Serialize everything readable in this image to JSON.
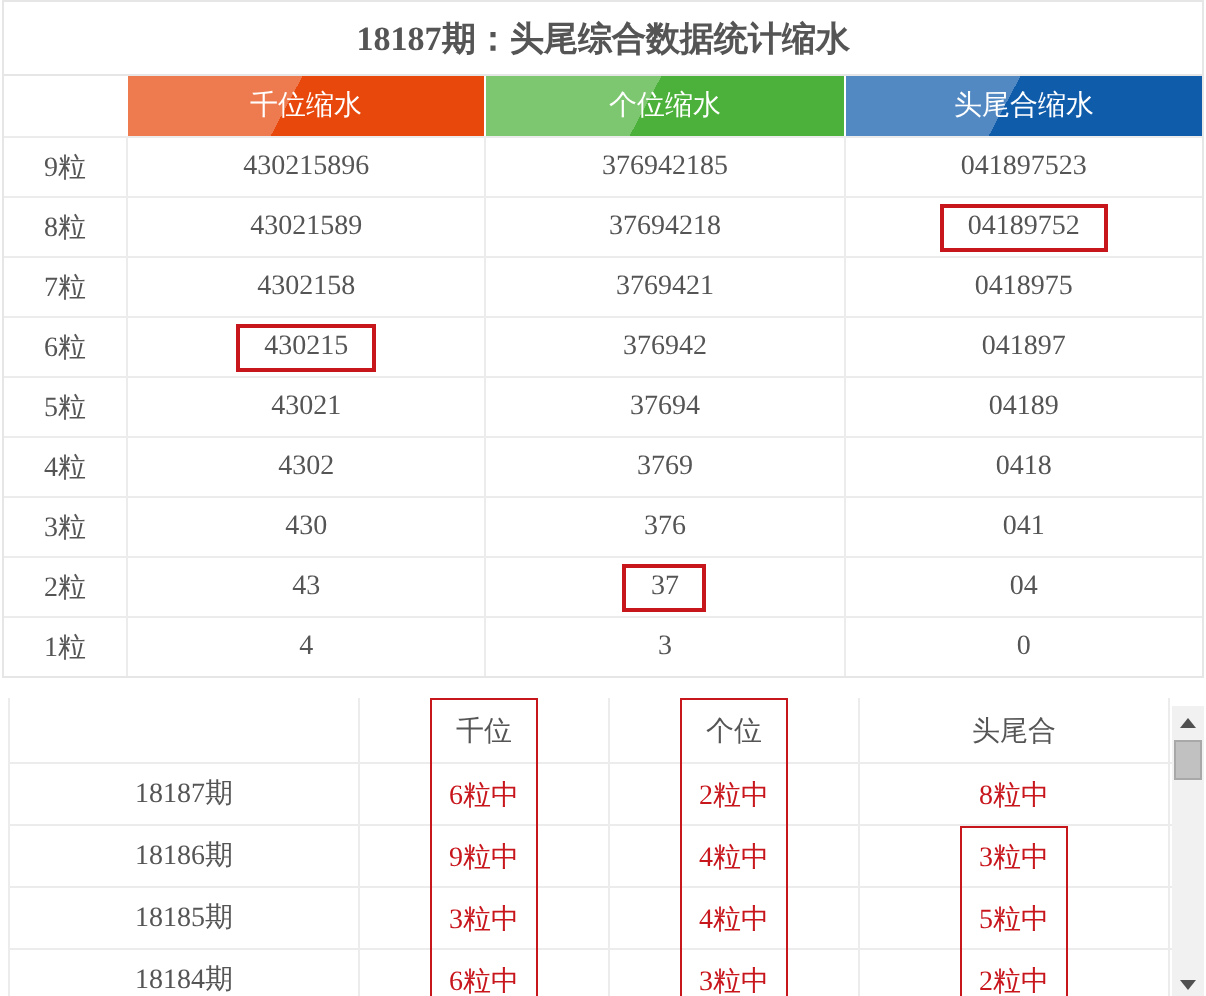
{
  "title": "18187期：头尾综合数据统计缩水",
  "columns": [
    {
      "label": "千位缩水",
      "color": "#e8480c"
    },
    {
      "label": "个位缩水",
      "color": "#4cb13a"
    },
    {
      "label": "头尾合缩水",
      "color": "#0f5cab"
    }
  ],
  "rows": [
    {
      "label": "9粒",
      "cells": [
        {
          "text": "430215896",
          "boxed": false
        },
        {
          "text": "376942185",
          "boxed": false
        },
        {
          "text": "041897523",
          "boxed": false
        }
      ]
    },
    {
      "label": "8粒",
      "cells": [
        {
          "text": "43021589",
          "boxed": false
        },
        {
          "text": "37694218",
          "boxed": false
        },
        {
          "text": "04189752",
          "boxed": true
        }
      ]
    },
    {
      "label": "7粒",
      "cells": [
        {
          "text": "4302158",
          "boxed": false
        },
        {
          "text": "3769421",
          "boxed": false
        },
        {
          "text": "0418975",
          "boxed": false
        }
      ]
    },
    {
      "label": "6粒",
      "cells": [
        {
          "text": "430215",
          "boxed": true
        },
        {
          "text": "376942",
          "boxed": false
        },
        {
          "text": "041897",
          "boxed": false
        }
      ]
    },
    {
      "label": "5粒",
      "cells": [
        {
          "text": "43021",
          "boxed": false
        },
        {
          "text": "37694",
          "boxed": false
        },
        {
          "text": "04189",
          "boxed": false
        }
      ]
    },
    {
      "label": "4粒",
      "cells": [
        {
          "text": "4302",
          "boxed": false
        },
        {
          "text": "3769",
          "boxed": false
        },
        {
          "text": "0418",
          "boxed": false
        }
      ]
    },
    {
      "label": "3粒",
      "cells": [
        {
          "text": "430",
          "boxed": false
        },
        {
          "text": "376",
          "boxed": false
        },
        {
          "text": "041",
          "boxed": false
        }
      ]
    },
    {
      "label": "2粒",
      "cells": [
        {
          "text": "43",
          "boxed": false
        },
        {
          "text": "37",
          "boxed": true
        },
        {
          "text": "04",
          "boxed": false
        }
      ]
    },
    {
      "label": "1粒",
      "cells": [
        {
          "text": "4",
          "boxed": false
        },
        {
          "text": "3",
          "boxed": false
        },
        {
          "text": "0",
          "boxed": false
        }
      ]
    }
  ],
  "results": {
    "columns": [
      {
        "label": "千位",
        "boxed": true
      },
      {
        "label": "个位",
        "boxed": true
      },
      {
        "label": "头尾合",
        "boxed": false
      }
    ],
    "rows": [
      {
        "period": "18187期",
        "cells": [
          {
            "text": "6粒中",
            "boxed": true
          },
          {
            "text": "2粒中",
            "boxed": true
          },
          {
            "text": "8粒中",
            "boxed": false
          }
        ]
      },
      {
        "period": "18186期",
        "cells": [
          {
            "text": "9粒中",
            "boxed": true
          },
          {
            "text": "4粒中",
            "boxed": true
          },
          {
            "text": "3粒中",
            "boxed": true
          }
        ]
      },
      {
        "period": "18185期",
        "cells": [
          {
            "text": "3粒中",
            "boxed": true
          },
          {
            "text": "4粒中",
            "boxed": true
          },
          {
            "text": "5粒中",
            "boxed": true
          }
        ]
      },
      {
        "period": "18184期",
        "cells": [
          {
            "text": "6粒中",
            "boxed": true
          },
          {
            "text": "3粒中",
            "boxed": true
          },
          {
            "text": "2粒中",
            "boxed": true
          }
        ]
      }
    ]
  }
}
